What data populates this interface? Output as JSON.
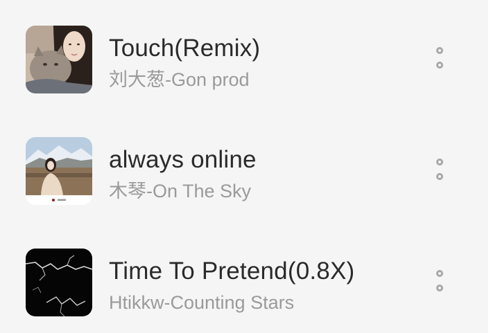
{
  "songs": [
    {
      "title": "Touch(Remix)",
      "subtitle": "刘大葱-Gon prod",
      "cover_icon": "album-cover-portrait-with-cat",
      "more_icon": "more-vertical-icon"
    },
    {
      "title": "always online",
      "subtitle": "木琴-On The Sky",
      "cover_icon": "album-cover-mountain-portrait",
      "more_icon": "more-vertical-icon"
    },
    {
      "title": "Time To Pretend(0.8X)",
      "subtitle": "Htikkw-Counting Stars",
      "cover_icon": "album-cover-lightning",
      "more_icon": "more-vertical-icon"
    }
  ],
  "colors": {
    "background": "#f5f5f5",
    "title": "#2a2a2a",
    "subtitle": "#9a9a9a",
    "more_icon": "#a7a7a7"
  }
}
